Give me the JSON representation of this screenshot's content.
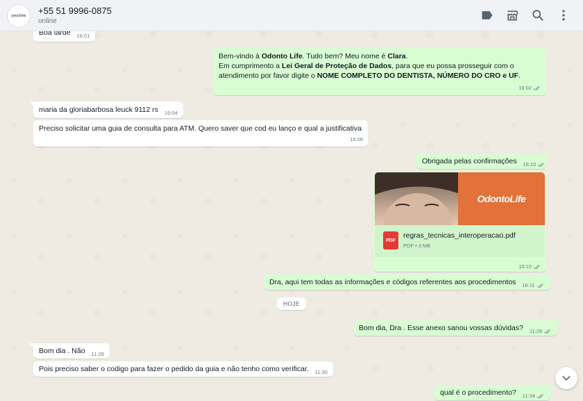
{
  "header": {
    "avatar_text": "youclinic",
    "contact_name": "+55 51 9996-0875",
    "status": "online"
  },
  "day_chip": "HOJE",
  "messages": {
    "m0": {
      "text": "Boa tarde",
      "time": "16:01"
    },
    "m1": {
      "l1a": "Bem-vindo à ",
      "l1b": "Odonto Life",
      "l1c": ". Tudo bem? Meu nome é ",
      "l1d": "Clara",
      "l1e": ".",
      "l2a": "Em cumprimento a ",
      "l2b": "Lei Geral de Proteção de Dados",
      "l2c": ", para que eu possa prosseguir com o",
      "l3a": "atendimento por favor digite o ",
      "l3b": "NOME COMPLETO DO DENTISTA, NÚMERO DO CRO e UF",
      "l3c": ".",
      "time": "16:02"
    },
    "m2": {
      "text": "maria da gloriabarbosa leuck 9112 rs",
      "time": "16:04"
    },
    "m3": {
      "text": "Preciso solicitar uma guia de consulta para ATM. Quero saver que cod eu lanço e qual a justificativa",
      "time": "16:06"
    },
    "m4": {
      "text": "Obrigada pelas confirmações",
      "time": "16:10"
    },
    "m5": {
      "logo": "OdontoLife",
      "file_name": "regras_tecnicas_interoperacao.pdf",
      "file_info": "PDF • 3 MB",
      "pdf_label": "PDF",
      "time": "16:10"
    },
    "m6": {
      "text": "Dra, aqui tem todas as informações e códigos referentes aos procedimentos",
      "time": "16:11"
    },
    "m7": {
      "text": "Bom dia, Dra . Esse anexo sanou vossas dúvidas?",
      "time": "11:28"
    },
    "m8": {
      "text": "Bom dia . Não",
      "time": "11:29"
    },
    "m9": {
      "text": "Pois preciso saber o codigo para fazer o pedido da guia e não tenho como verificar.",
      "time": "11:30"
    },
    "m10": {
      "text": "qual é o procedimento?",
      "time": "11:34"
    }
  },
  "icons": [
    "label-icon",
    "catalog-icon",
    "search-icon",
    "menu-icon",
    "chevron-down-icon",
    "double-check-icon",
    "pdf-icon"
  ],
  "colors": {
    "outgoing": "#d9fdd3",
    "incoming": "#ffffff",
    "background": "#efeae2",
    "header": "#f0f2f5"
  }
}
